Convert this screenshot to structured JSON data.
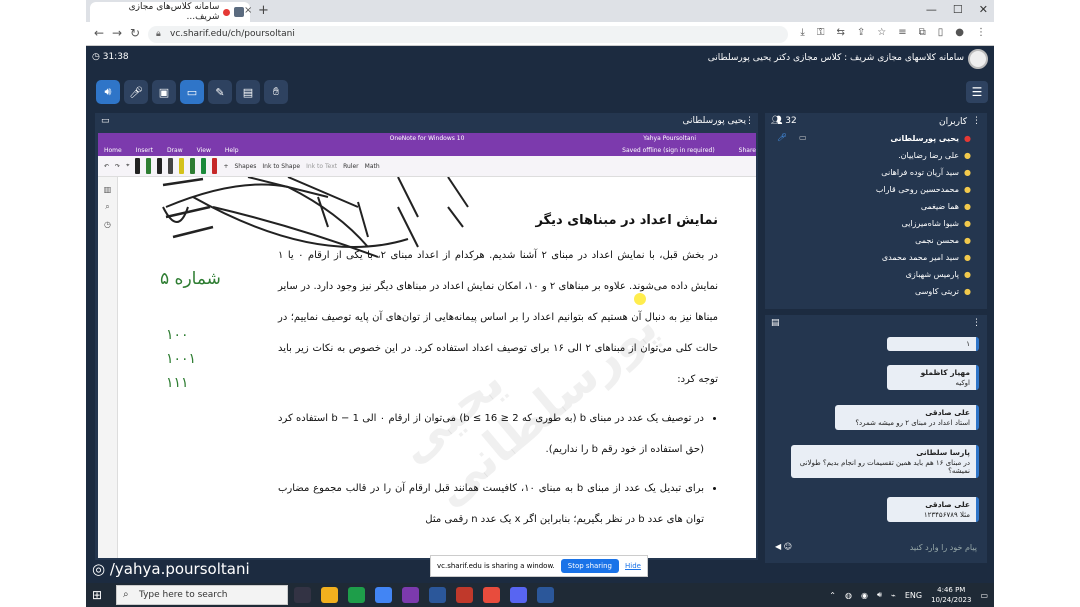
{
  "browser": {
    "tab_title": "سامانه کلاس‌های مجازی شریف...",
    "tab_close": "×",
    "new_tab": "+",
    "url": "vc.sharif.edu/ch/poursoltani"
  },
  "app": {
    "timer": "31:38",
    "title": "سامانه کلاسهای مجازی شریف : کلاس مجازی دکتر یحیی پورسلطانی"
  },
  "presenter": {
    "panel_title": "یحیی پورسلطانی",
    "onenote_title": "OneNote for Windows 10",
    "onenote_account": "Yahya Poursoltani",
    "menu_items": [
      "Home",
      "Insert",
      "Draw",
      "View",
      "Help"
    ],
    "saved_status": "Saved offline (sign in required)",
    "share_label": "Share",
    "tools": [
      "Shapes",
      "Ink to Shape",
      "Ink to Text",
      "Ruler",
      "Math"
    ],
    "doc": {
      "heading": "نمایش اعداد در مبناهای دیگر",
      "para1": "در بخش قبل، با نمایش اعداد در مبنای ۲ آشنا شدیم. هرکدام از اعداد مبنای ۲، با یکی از ارقام ۰ یا ۱ نمایش داده می‌شوند. علاوه بر مبناهای ۲ و ۱۰، امکان نمایش اعداد در مبناهای دیگر نیز وجود دارد. در سایر مبناها نیز به دنبال آن هستیم که بتوانیم اعداد را بر اساس پیمانه‌هایی از توان‌های آن پایه توصیف نماییم؛ در حالت کلی می‌توان از مبناهای ۲ الی ۱۶ برای توصیف اعداد استفاده کرد. در این خصوص به نکات زیر باید توجه کرد:",
      "bullet1": "در توصیف یک عدد در مبنای b (به طوری که 2 ≤ b ≤ 16) می‌توان از ارقام ۰ الی b − 1 استفاده کرد (حق استفاده از خود رقم b را نداریم).",
      "bullet2": "برای تبدیل یک عدد از مبنای b به مبنای ۱۰، کافیست همانند قبل ارقام آن را در قالب مجموع مضارب توان های عدد b در نظر بگیریم؛ بنابراین اگر x یک عدد n رقمی مثل"
    },
    "ink_word": "شماره ۵",
    "ink_digits": [
      "١٠٠",
      "١٠٠١",
      "١١١"
    ],
    "watermark": "یحیی پورسلطانی",
    "share_bar": {
      "text": "vc.sharif.edu is sharing a window.",
      "stop": "Stop sharing",
      "hide": "Hide"
    },
    "name_watermark": "/yahya.poursoltani"
  },
  "users": {
    "title": "کاربران",
    "count": "32",
    "list": [
      "یحیی پورسلطانی",
      "علی رضا رضاییان.",
      "سید آریان توده فراهانی",
      "محمدحسین روحی قاراب",
      "هما ضیغمی",
      "شیوا شاه‌میرزایی",
      "محسن نجمی",
      "سید امیر محمد محمدی",
      "پارمیس شهبازی",
      "تریتی کاوسی"
    ]
  },
  "chat": {
    "messages": [
      {
        "name": "",
        "text": "۱"
      },
      {
        "name": "مهیار کاظملو",
        "text": "اوکیه"
      },
      {
        "name": "علی صادقی",
        "text": "استاد اعداد در مبنای ۲ رو میشه شمرد؟"
      },
      {
        "name": "پارسا سلطانی",
        "text": "در مبنای ۱۶ هم باید همین تقسیمات رو انجام بدیم؟ طولانی نمیشه؟"
      },
      {
        "name": "علی صادقی",
        "text": "مثلا ۱۲۳۴۵۶۷۸۹"
      }
    ],
    "placeholder": "پیام خود را وارد کنید"
  },
  "taskbar": {
    "search_placeholder": "Type here to search",
    "lang": "ENG",
    "time": "4:46 PM",
    "date": "10/24/2023"
  },
  "colors": {
    "frame": "#1c2b40",
    "panel": "#24364f",
    "onenote": "#7c3aad",
    "accent": "#2f75c8"
  }
}
